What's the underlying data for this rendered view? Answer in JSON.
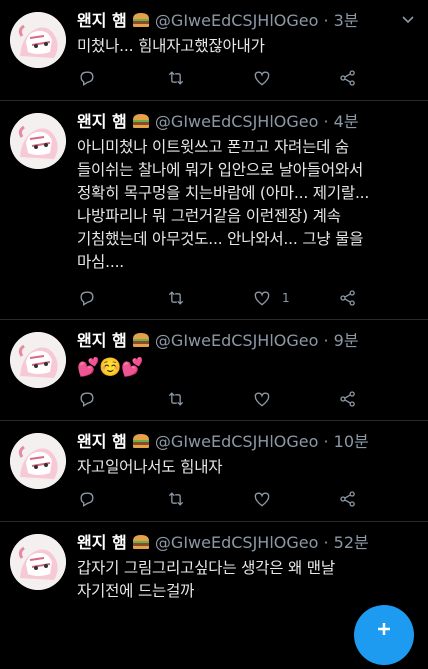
{
  "tweets": [
    {
      "name": "왠지 햄",
      "handle": "@GIweEdCSJHlOGeo",
      "time": "· 3분",
      "text": "미쳤나... 힘내자고했잖아내가",
      "reply_count": "",
      "retweet_count": "",
      "like_count": ""
    },
    {
      "name": "왠지 햄",
      "handle": "@GIweEdCSJHlOGeo",
      "time": "· 4분",
      "text": "아니미쳤나 이트윗쓰고 폰끄고 자려는데 숨\n들이쉬는 찰나에 뭐가 입안으로 날아들어와서\n정확히 목구멍을 치는바람에 (아마... 제기랄...\n나방파리나 뭐 그런거같음 이런젠장) 계속\n기침했는데 아무것도... 안나와서... 그냥 물을\n마심....",
      "reply_count": "",
      "retweet_count": "",
      "like_count": "1"
    },
    {
      "name": "왠지 햄",
      "handle": "@GIweEdCSJHlOGeo",
      "time": "· 9분",
      "text": "💕☺️💕",
      "reply_count": "",
      "retweet_count": "",
      "like_count": ""
    },
    {
      "name": "왠지 햄",
      "handle": "@GIweEdCSJHlOGeo",
      "time": "· 10분",
      "text": "자고일어나서도 힘내자",
      "reply_count": "",
      "retweet_count": "",
      "like_count": ""
    },
    {
      "name": "왠지 햄",
      "handle": "@GIweEdCSJHlOGeo",
      "time": "· 52분",
      "text": "갑자기 그림그리고싶다는 생각은 왜 맨날\n자기전에 드는걸까",
      "reply_count": "",
      "retweet_count": "",
      "like_count": ""
    }
  ],
  "colors": {
    "background": "#000000",
    "accent": "#1d9bf0",
    "secondary_text": "#8b98a5"
  },
  "icons": [
    "hamburger-emoji",
    "chevron-down-icon",
    "reply-icon",
    "retweet-icon",
    "like-icon",
    "share-icon",
    "compose-icon"
  ]
}
